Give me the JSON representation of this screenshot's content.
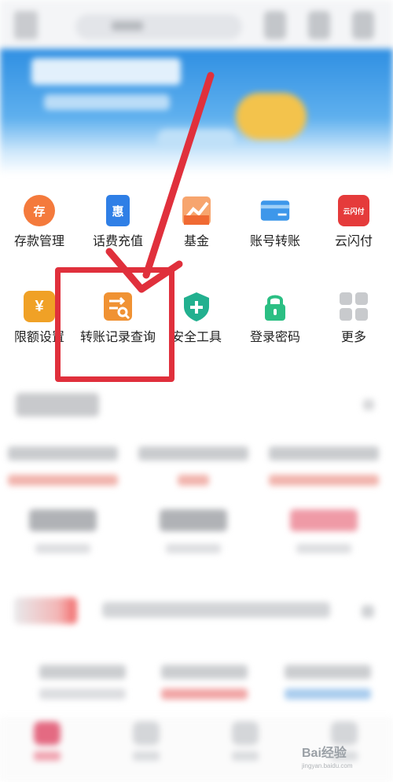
{
  "services_row1": [
    {
      "label": "存款管理",
      "icon": "piggy-bank-icon",
      "glyph": "存",
      "color": "#f47a3c"
    },
    {
      "label": "话费充值",
      "icon": "phone-topup-icon",
      "glyph": "惠",
      "color": "#2f7fe6"
    },
    {
      "label": "基金",
      "icon": "fund-chart-icon",
      "glyph": "",
      "color": "#f06a33"
    },
    {
      "label": "账号转账",
      "icon": "card-transfer-icon",
      "glyph": "",
      "color": "#3d97ea"
    },
    {
      "label": "云闪付",
      "icon": "unionpay-icon",
      "glyph": "云闪付",
      "color": "#e53b3b"
    }
  ],
  "services_row2": [
    {
      "label": "限额设置",
      "icon": "limit-settings-icon",
      "glyph": "¥",
      "color": "#f0a126"
    },
    {
      "label": "转账记录查询",
      "icon": "transfer-record-search-icon",
      "glyph": "⇄",
      "color": "#f09233"
    },
    {
      "label": "安全工具",
      "icon": "shield-plus-icon",
      "glyph": "+",
      "color": "#22b08f"
    },
    {
      "label": "登录密码",
      "icon": "lock-icon",
      "glyph": "",
      "color": "#2bbf83"
    },
    {
      "label": "更多",
      "icon": "more-grid-icon",
      "glyph": "",
      "color": "#c8cacd"
    }
  ],
  "watermark": {
    "text": "Bai经验",
    "url": "jingyan.baidu.com"
  },
  "colors": {
    "annotation": "#e0303c",
    "banner": "#2f8fe2"
  }
}
